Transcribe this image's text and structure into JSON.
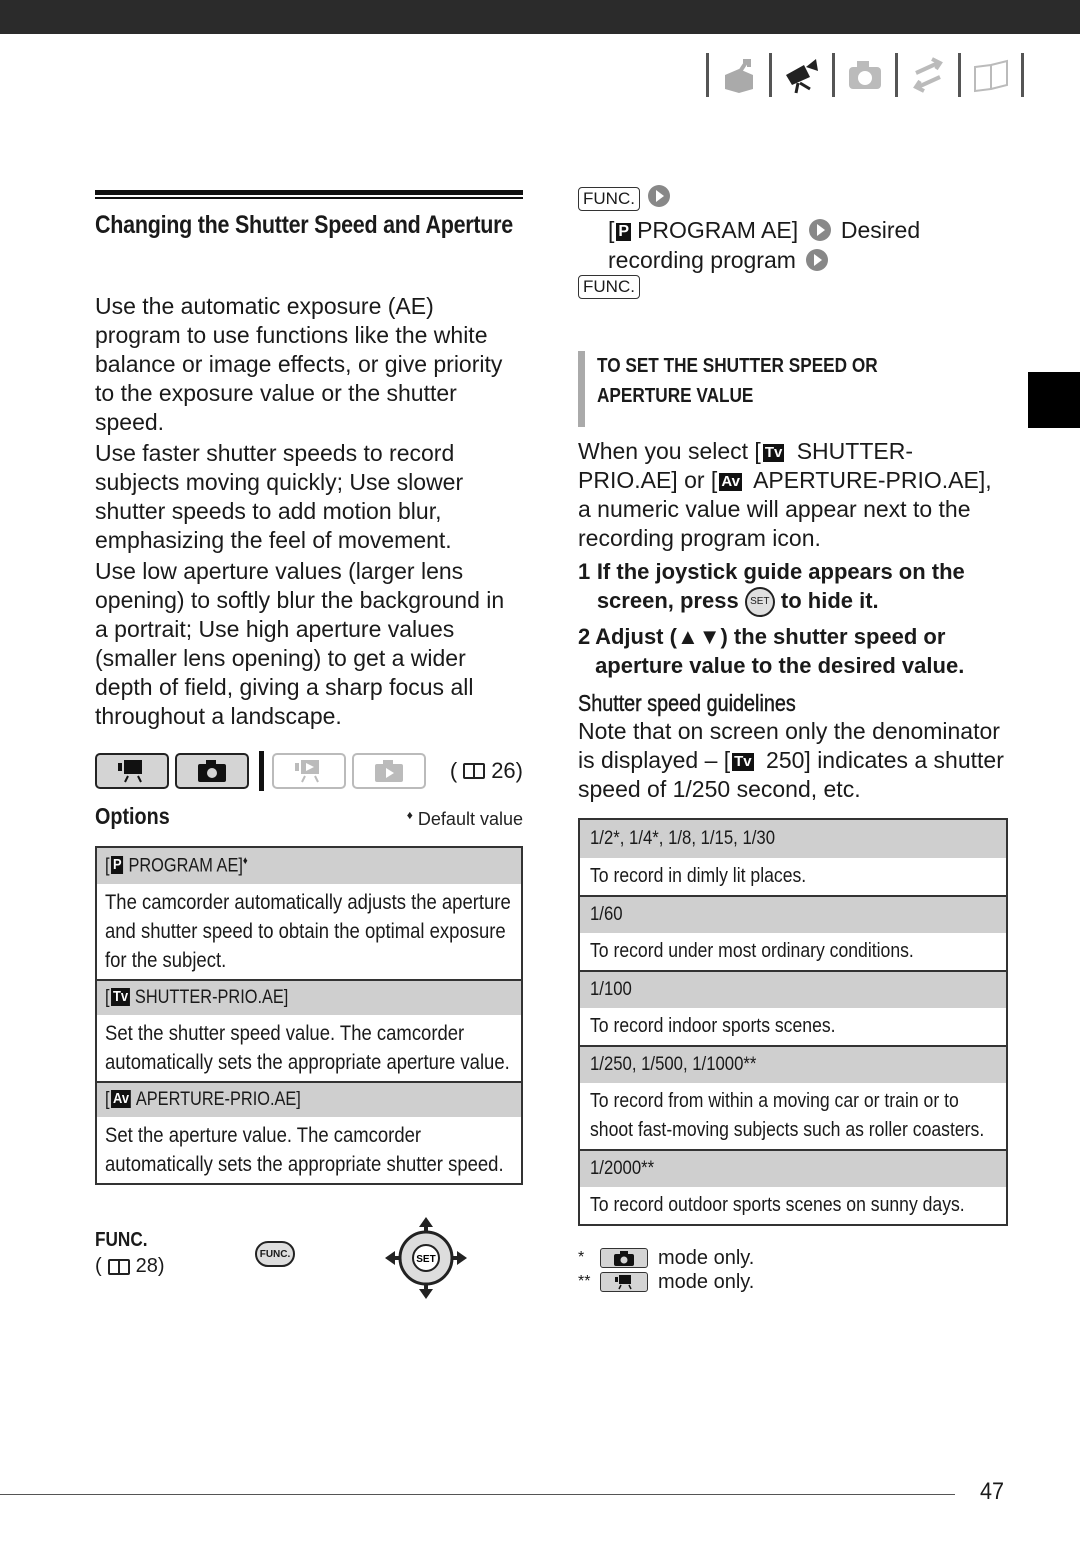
{
  "header": {
    "nav_icons": [
      "box-arrow-icon",
      "movie-camera-icon",
      "camera-icon",
      "transfer-arrows-icon",
      "book-icon"
    ],
    "active_icon": "movie-camera-icon"
  },
  "left": {
    "title": "Changing the Shutter Speed and Aperture",
    "paragraphs": [
      "Use the automatic exposure (AE) program to use functions like the white balance or image effects, or give priority to the exposure value or the shutter speed.",
      "Use faster shutter speeds to record subjects moving quickly; Use slower shutter speeds to add motion blur, emphasizing the feel of movement.",
      "Use low aperture values (larger lens opening) to softly blur the background in a portrait; Use high aperture values (smaller lens opening) to get a wider depth of field, giving a sharp focus all throughout a landscape."
    ],
    "page_ref": "26",
    "options_title": "Options",
    "default_note": "Default value",
    "options": [
      {
        "badge": "P",
        "label": "PROGRAM AE]",
        "default": "♦",
        "desc": "The camcorder automatically adjusts the aperture and shutter speed to obtain the optimal exposure for the subject."
      },
      {
        "badge": "Tv",
        "label": "SHUTTER-PRIO.AE]",
        "default": "",
        "desc": "Set the shutter speed value. The camcorder automatically sets the appropriate aperture value."
      },
      {
        "badge": "Av",
        "label": "APERTURE-PRIO.AE]",
        "default": "",
        "desc": "Set the aperture value. The camcorder automatically sets the appropriate shutter speed."
      }
    ],
    "func_label": "FUNC.",
    "func_ref": "28",
    "func_button": "FUNC.",
    "joystick_label": "SET"
  },
  "right": {
    "func_chip": "FUNC.",
    "menu_path_1": "PROGRAM AE]",
    "menu_path_2": "Desired",
    "menu_path_3": "recording program",
    "subsection_title": "To set the shutter speed or aperture value",
    "intro_1": "When you select [",
    "intro_2": " SHUTTER-PRIO.AE] or [",
    "intro_3": " APERTURE-PRIO.AE], a numeric value will appear next to the recording program icon.",
    "steps": [
      {
        "num": "1",
        "text_a": "If the joystick guide appears on the screen, press ",
        "text_b": " to hide it.",
        "icon": "SET"
      },
      {
        "num": "2",
        "text_a": "Adjust (▲▼) the shutter speed or aperture value to the desired value.",
        "text_b": "",
        "icon": ""
      }
    ],
    "guide_title": "Shutter speed guidelines",
    "guide_note_1": "Note that on screen only the denominator is displayed – [",
    "guide_note_2": " 250] indicates a shutter speed of 1/250 second, etc.",
    "guidelines": [
      {
        "speeds": "1/2*, 1/4*, 1/8, 1/15, 1/30",
        "desc": "To record in dimly lit places."
      },
      {
        "speeds": "1/60",
        "desc": "To record under most ordinary conditions."
      },
      {
        "speeds": "1/100",
        "desc": "To record indoor sports scenes."
      },
      {
        "speeds": "1/250, 1/500, 1/1000**",
        "desc": "To record from within a moving car or train or to shoot fast-moving subjects such as roller coasters."
      },
      {
        "speeds": "1/2000**",
        "desc": "To record outdoor sports scenes on sunny days."
      }
    ],
    "footnotes": [
      {
        "mark": "*",
        "icon": "camera-icon",
        "text": "mode only."
      },
      {
        "mark": "**",
        "icon": "movie-camera-icon",
        "text": "mode only."
      }
    ]
  },
  "footer": {
    "page_number": "47"
  }
}
